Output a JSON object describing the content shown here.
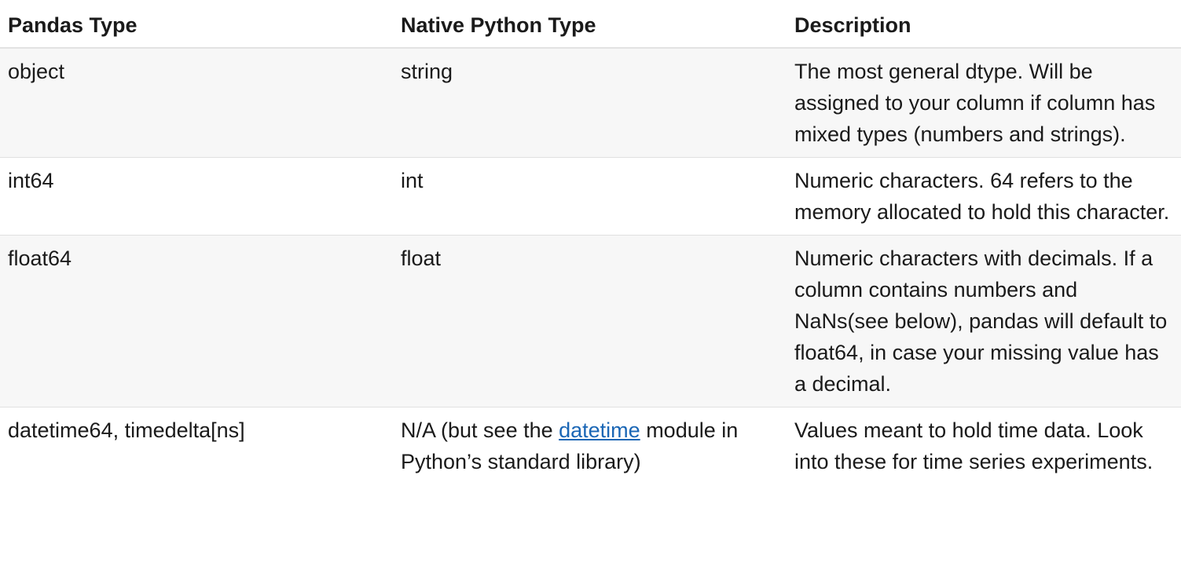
{
  "table": {
    "headers": [
      "Pandas Type",
      "Native Python Type",
      "Description"
    ],
    "rows": [
      {
        "pandas_type": "object",
        "python_type": "string",
        "description": "The most general dtype. Will be assigned to your column if column has mixed types (numbers and strings)."
      },
      {
        "pandas_type": "int64",
        "python_type": "int",
        "description": "Numeric characters. 64 refers to the memory allocated to hold this character."
      },
      {
        "pandas_type": "float64",
        "python_type": "float",
        "description": "Numeric characters with decimals. If a column contains numbers and NaNs(see below), pandas will default to float64, in case your missing value has a decimal."
      },
      {
        "pandas_type": "datetime64, timedelta[ns]",
        "python_type_prefix": "N/A (but see the ",
        "python_type_link": "datetime",
        "python_type_suffix": " module in Python’s standard library)",
        "description": "Values meant to hold time data. Look into these for time series experiments."
      }
    ]
  },
  "colors": {
    "link": "#1a66b5",
    "stripe": "#f7f7f7"
  }
}
